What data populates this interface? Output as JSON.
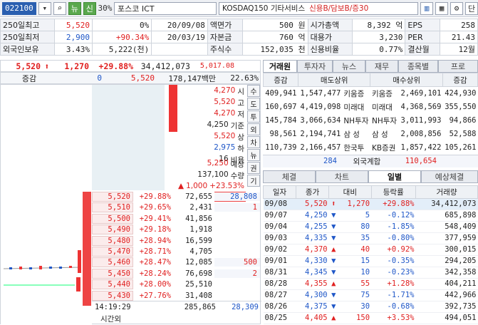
{
  "toolbar": {
    "code": "022100",
    "fund": "뉴",
    "credit": "신",
    "margin": "30%",
    "name": "포스코 ICT",
    "sector": "KOSDAQ150 기타서비스",
    "tags": "신용B/담보B/증30",
    "single": "단"
  },
  "info": {
    "rows": [
      [
        "250일최고",
        "5,520",
        "0%",
        "20/09/08",
        "액면가",
        "500 원",
        "시가총액",
        "8,392 억",
        "EPS",
        "258"
      ],
      [
        "250일최저",
        "2,900",
        "+90.34%",
        "20/03/19",
        "자본금",
        "760 억",
        "대용가",
        "3,230",
        "PER",
        "21.43"
      ],
      [
        "외국인보유",
        "3.43%",
        "5,222(천)",
        "",
        "주식수",
        "152,035 천",
        "신용비율",
        "0.77%",
        "결산월",
        "12월"
      ]
    ]
  },
  "price": {
    "current": "5,520",
    "change": "1,270",
    "rate": "+29.88%",
    "volume": "34,412,073",
    "prev": "5,017.08"
  },
  "sum": {
    "label": "증감",
    "left": "0",
    "price": "5,520",
    "amount": "178,147백만",
    "ratio": "22.63%"
  },
  "summary": [
    {
      "val": "4,270",
      "lbl": "시"
    },
    {
      "val": "5,520",
      "lbl": "고"
    },
    {
      "val": "4,270",
      "lbl": "저"
    },
    {
      "val": "4,250",
      "lbl": "기준"
    },
    {
      "val": "5,520",
      "lbl": "상"
    },
    {
      "val": "2,975",
      "lbl": "하"
    },
    {
      "val": "16",
      "lbl": "비용"
    }
  ],
  "expect": {
    "price": "5,250",
    "label": "예상",
    "qty": "137,100",
    "qlabel": "수량",
    "change": "1,000",
    "rate": "+23.53%"
  },
  "sidetabs": [
    "수",
    "도",
    "투",
    "외",
    "차",
    "뉴",
    "권",
    "기"
  ],
  "bids": [
    [
      "5,520",
      "+29.88%",
      "72,655",
      "28,808"
    ],
    [
      "5,510",
      "+29.65%",
      "2,431",
      "1"
    ],
    [
      "5,500",
      "+29.41%",
      "41,856",
      ""
    ],
    [
      "5,490",
      "+29.18%",
      "1,918",
      ""
    ],
    [
      "5,480",
      "+28.94%",
      "16,599",
      ""
    ],
    [
      "5,470",
      "+28.71%",
      "4,705",
      ""
    ],
    [
      "5,460",
      "+28.47%",
      "12,085",
      "500"
    ],
    [
      "5,450",
      "+28.24%",
      "76,698",
      "2"
    ],
    [
      "5,440",
      "+28.00%",
      "25,510",
      ""
    ],
    [
      "5,430",
      "+27.76%",
      "31,408",
      ""
    ]
  ],
  "footer": {
    "time": "14:19:29",
    "label": "시간외",
    "total": "285,865",
    "side": "28,309"
  },
  "rtabs": [
    "거래원",
    "투자자",
    "뉴스",
    "재무",
    "종목별",
    "프로"
  ],
  "broker": {
    "h": [
      "증감",
      "매도상위",
      "매수상위",
      "증감"
    ],
    "rows": [
      [
        "409,941",
        "1,547,477",
        "키움증",
        "키움증",
        "2,469,101",
        "424,930"
      ],
      [
        "160,697",
        "4,419,098",
        "미래대",
        "미래대",
        "4,368,569",
        "355,550"
      ],
      [
        "145,784",
        "3,066,634",
        "NH투자",
        "NH투자",
        "3,011,993",
        "94,866"
      ],
      [
        "98,561",
        "2,194,741",
        "삼 성",
        "삼 성",
        "2,008,856",
        "52,588"
      ],
      [
        "110,739",
        "2,166,457",
        "한국투",
        "KB증권",
        "1,857,422",
        "105,261"
      ]
    ],
    "foreign": [
      "284",
      "외국계합",
      "110,654"
    ]
  },
  "btabs": [
    "체결",
    "차트",
    "일별",
    "예상체결"
  ],
  "daily": {
    "h": [
      "일자",
      "종가",
      "대비",
      "등락률",
      "거래량"
    ],
    "rows": [
      [
        "09/08",
        "5,520",
        "up",
        "1,270",
        "+29.88%",
        "34,412,073"
      ],
      [
        "09/07",
        "4,250",
        "dn",
        "5",
        "-0.12%",
        "685,898"
      ],
      [
        "09/04",
        "4,255",
        "dn",
        "80",
        "-1.85%",
        "548,409"
      ],
      [
        "09/03",
        "4,335",
        "dn",
        "35",
        "-0.80%",
        "377,959"
      ],
      [
        "09/02",
        "4,370",
        "up",
        "40",
        "+0.92%",
        "300,015"
      ],
      [
        "09/01",
        "4,330",
        "dn",
        "15",
        "-0.35%",
        "294,205"
      ],
      [
        "08/31",
        "4,345",
        "dn",
        "10",
        "-0.23%",
        "342,358"
      ],
      [
        "08/28",
        "4,355",
        "up",
        "55",
        "+1.28%",
        "404,211"
      ],
      [
        "08/27",
        "4,300",
        "dn",
        "75",
        "-1.71%",
        "442,966"
      ],
      [
        "08/26",
        "4,375",
        "dn",
        "30",
        "-0.68%",
        "392,735"
      ],
      [
        "08/25",
        "4,405",
        "up",
        "150",
        "+3.53%",
        "494,051"
      ]
    ]
  }
}
